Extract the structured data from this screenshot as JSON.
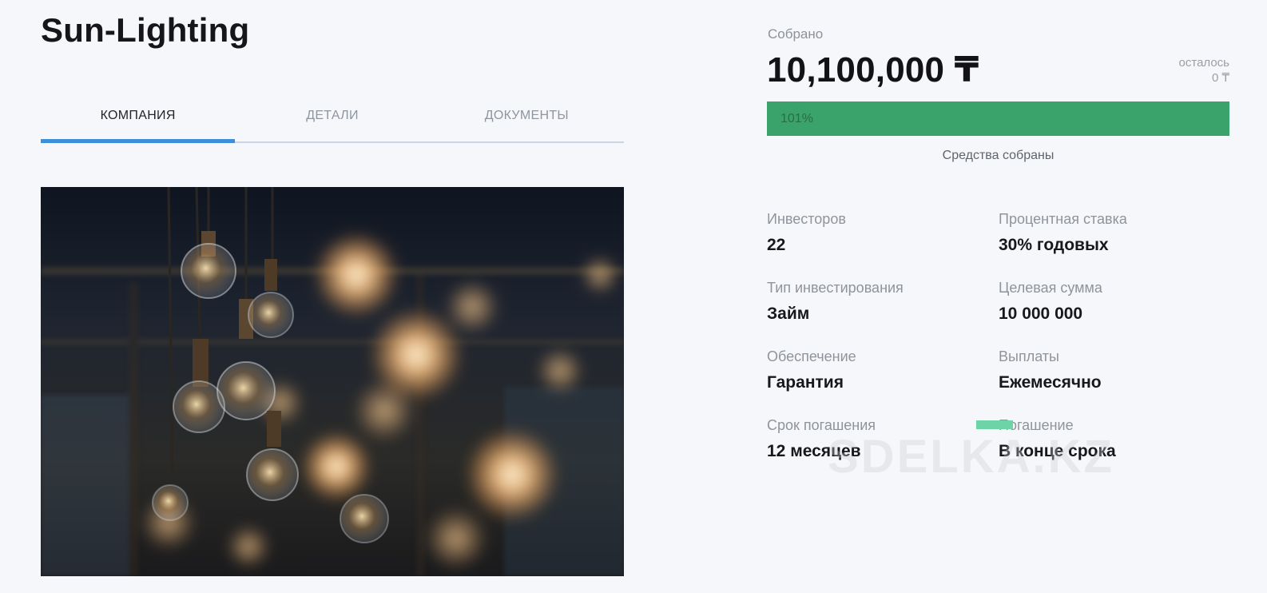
{
  "project": {
    "title": "Sun-Lighting"
  },
  "tabs": [
    {
      "label": "КОМПАНИЯ",
      "active": true
    },
    {
      "label": "ДЕТАЛИ",
      "active": false
    },
    {
      "label": "ДОКУМЕНТЫ",
      "active": false
    }
  ],
  "funding": {
    "raised_label": "Собрано",
    "raised_amount": "10,100,000 ₸",
    "remaining_label": "осталось",
    "remaining_value": "0 ₸",
    "progress_text": "101%",
    "progress_fraction": 1.0,
    "status_text": "Средства собраны"
  },
  "stats": [
    {
      "label": "Инвесторов",
      "value": "22"
    },
    {
      "label": "Процентная ставка",
      "value": "30% годовых"
    },
    {
      "label": "Тип инвестирования",
      "value": "Займ"
    },
    {
      "label": "Целевая сумма",
      "value": "10 000 000"
    },
    {
      "label": "Обеспечение",
      "value": "Гарантия"
    },
    {
      "label": "Выплаты",
      "value": "Ежемесячно"
    },
    {
      "label": "Срок погашения",
      "value": "12 месяцев"
    },
    {
      "label": "Погашение",
      "value": "В конце срока"
    }
  ],
  "watermark": "SDELKA.KZ",
  "colors": {
    "accent": "#3d8fd8",
    "progress": "#3aa36b",
    "background": "#f6f7fb"
  }
}
